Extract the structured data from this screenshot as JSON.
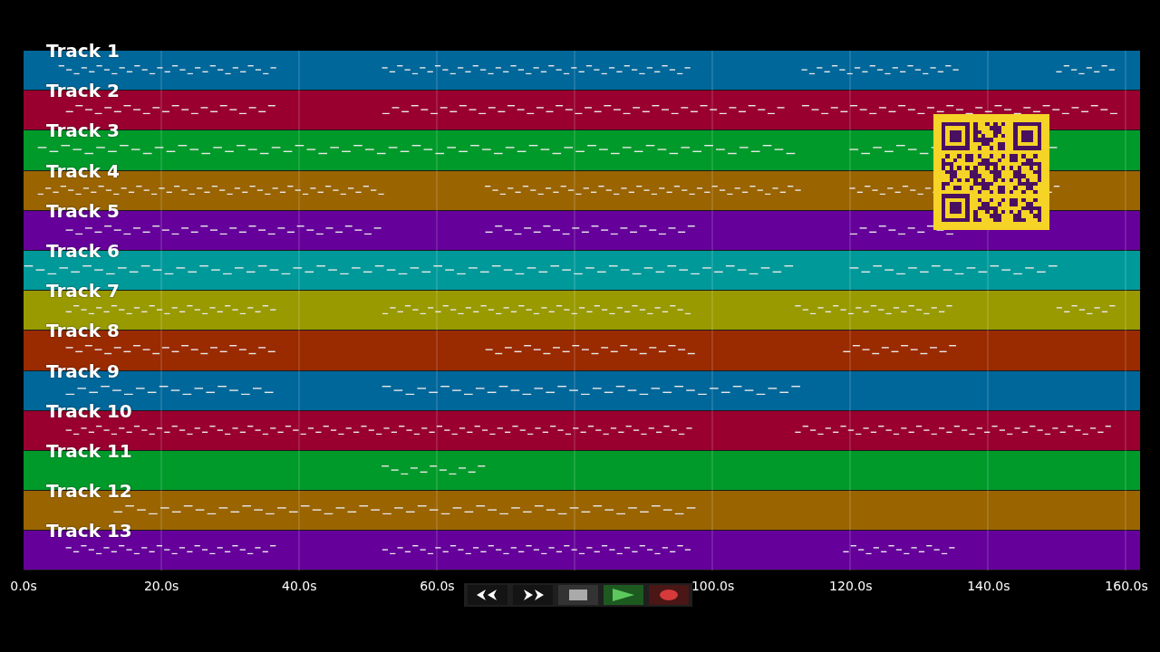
{
  "tracks": [
    {
      "name": "Track 1",
      "color": "#00679a"
    },
    {
      "name": "Track 2",
      "color": "#99002f"
    },
    {
      "name": "Track 3",
      "color": "#009a2a"
    },
    {
      "name": "Track 4",
      "color": "#9a6400"
    },
    {
      "name": "Track 5",
      "color": "#65009a"
    },
    {
      "name": "Track 6",
      "color": "#00999a"
    },
    {
      "name": "Track 7",
      "color": "#999a00"
    },
    {
      "name": "Track 8",
      "color": "#9a2a00"
    },
    {
      "name": "Track 9",
      "color": "#00679a"
    },
    {
      "name": "Track 10",
      "color": "#99002f"
    },
    {
      "name": "Track 11",
      "color": "#009a2a"
    },
    {
      "name": "Track 12",
      "color": "#9a6400"
    },
    {
      "name": "Track 13",
      "color": "#65009a"
    }
  ],
  "time_axis": {
    "ticks": [
      "0.0s",
      "20.0s",
      "40.0s",
      "60.0s",
      "100.0s",
      "120.0s",
      "140.0s",
      "160.0s"
    ]
  }
}
